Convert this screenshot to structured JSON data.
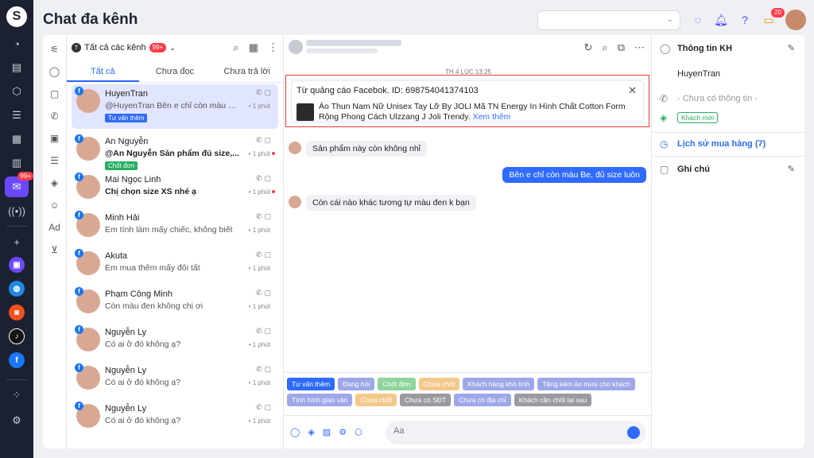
{
  "app": {
    "title": "Chat đa kênh"
  },
  "header": {
    "notif_count": "20"
  },
  "nav": {
    "badge": "99+"
  },
  "list": {
    "channel_label": "Tất cả các kênh",
    "channel_count": "99+",
    "tabs": [
      "Tất cả",
      "Chưa đọc",
      "Chưa trả lời"
    ],
    "conversations": [
      {
        "name": "HuyenTran",
        "message": "@HuyenTran Bên e chỉ còn màu Be,...",
        "time": "• 1 phút",
        "tag": "Tư vấn thêm",
        "tag_color": "#2f6bff",
        "bold": false
      },
      {
        "name": "An Nguyễn",
        "message": "@An Nguyễn Sản phẩm đủ size,...",
        "time": "• 1 phút",
        "tag": "Chốt đơn",
        "tag_color": "#27ae60",
        "bold": true
      },
      {
        "name": "Mai Ngọc Linh",
        "message": "Chị chọn size XS nhé ạ",
        "time": "• 1 phút",
        "tag": "",
        "bold": true
      },
      {
        "name": "Minh Hải",
        "message": "Em tính làm mấy chiếc, không biết",
        "time": "• 1 phút",
        "tag": "",
        "bold": false
      },
      {
        "name": "Akuta",
        "message": "Em mua thêm mấy đôi tất",
        "time": "• 1 phút",
        "tag": "",
        "bold": false
      },
      {
        "name": "Phạm Công Minh",
        "message": "Còn màu đen không chị ơi",
        "time": "• 1 phút",
        "tag": "",
        "bold": false
      },
      {
        "name": "Nguyễn Ly",
        "message": "Có ai ở đó không ạ?",
        "time": "• 1 phút",
        "tag": "",
        "bold": false
      },
      {
        "name": "Nguyễn Ly",
        "message": "Có ai ở đó không ạ?",
        "time": "• 1 phút",
        "tag": "",
        "bold": false
      },
      {
        "name": "Nguyễn Ly",
        "message": "Có ai ở đó không ạ?",
        "time": "• 1 phút",
        "tag": "",
        "bold": false
      }
    ]
  },
  "chat": {
    "date_label": "TH 4 LÚC 13:25",
    "ad_title": "Từ quảng cáo Facebok. ID: 698754041374103",
    "ad_desc": "Áo Thun Nam Nữ Unisex Tay Lỡ By JOLI Mã TN Energy In Hình Chất Cotton Form Rộng Phong Cách Ulzzang J Joli Trendy.",
    "ad_link": "Xem thêm",
    "messages": [
      {
        "text": "Sản phẩm này còn không nhỉ",
        "dir": "in"
      },
      {
        "text": "Bên e chỉ còn màu Be, đủ size luôn",
        "dir": "out"
      },
      {
        "text": "Còn cái nào khác tương tự màu đen k bạn",
        "dir": "in"
      }
    ],
    "tags": [
      {
        "label": "Tư vấn thêm",
        "color": "#2f6bff"
      },
      {
        "label": "Đang hỏi",
        "color": "#9ea8e8"
      },
      {
        "label": "Chốt đơn",
        "color": "#8fd49c"
      },
      {
        "label": "Chưa chốt",
        "color": "#f3c98b"
      },
      {
        "label": "Khách hàng khó tính",
        "color": "#9ea8e8"
      },
      {
        "label": "Tặng kèm áo mưa cho khách",
        "color": "#9ea8e8"
      },
      {
        "label": "Tình hình giao vận",
        "color": "#9ea8e8"
      },
      {
        "label": "Chưa chốt",
        "color": "#f3c98b"
      },
      {
        "label": "Chưa có SĐT",
        "color": "#9a9aa3"
      },
      {
        "label": "Chưa có địa chỉ",
        "color": "#9ea8e8"
      },
      {
        "label": "Khách cần chốt lại sau",
        "color": "#9a9aa3"
      }
    ],
    "input_placeholder": "Aa"
  },
  "info": {
    "title": "Thông tin KH",
    "name": "HuyenTran",
    "phone": "- Chưa có thông tin -",
    "customer_tag": "Khách mới",
    "history": "Lịch sử mua hàng (7)",
    "notes": "Ghi chú"
  },
  "colors": {
    "accent": "#2f6bff",
    "nav_bg": "#1b2130",
    "highlight": "#e53935"
  }
}
